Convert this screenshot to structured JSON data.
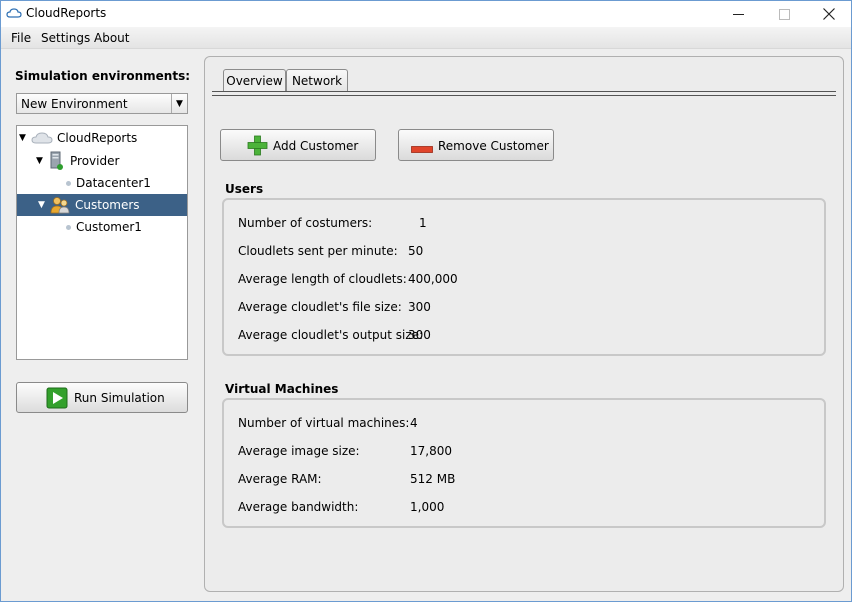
{
  "window": {
    "title": "CloudReports"
  },
  "menu": {
    "items": [
      "File",
      "Settings",
      "About"
    ]
  },
  "sidebar": {
    "env_label": "Simulation environments:",
    "env_selected": "New Environment",
    "tree": {
      "root": "CloudReports",
      "provider": "Provider",
      "datacenter": "Datacenter1",
      "customers": "Customers",
      "customer": "Customer1"
    },
    "run_label": "Run Simulation"
  },
  "tabs": {
    "overview": "Overview",
    "network": "Network"
  },
  "buttons": {
    "add": "Add Customer",
    "remove": "Remove Customer"
  },
  "users": {
    "title": "Users",
    "fields": [
      {
        "label": "Number of costumers:",
        "value": "1"
      },
      {
        "label": "Cloudlets sent per minute:",
        "value": "50"
      },
      {
        "label": "Average length of cloudlets:",
        "value": "400,000"
      },
      {
        "label": "Average cloudlet's file size:",
        "value": "300"
      },
      {
        "label": "Average cloudlet's output size:",
        "value": "300"
      }
    ]
  },
  "vms": {
    "title": "Virtual Machines",
    "fields": [
      {
        "label": "Number of virtual machines:",
        "value": "4"
      },
      {
        "label": "Average image size:",
        "value": "17,800"
      },
      {
        "label": "Average RAM:",
        "value": "512 MB"
      },
      {
        "label": "Average bandwidth:",
        "value": "1,000"
      }
    ]
  },
  "colors": {
    "selection": "#3c6187",
    "accent_green": "#3aa83a",
    "accent_red": "#d9401e"
  }
}
